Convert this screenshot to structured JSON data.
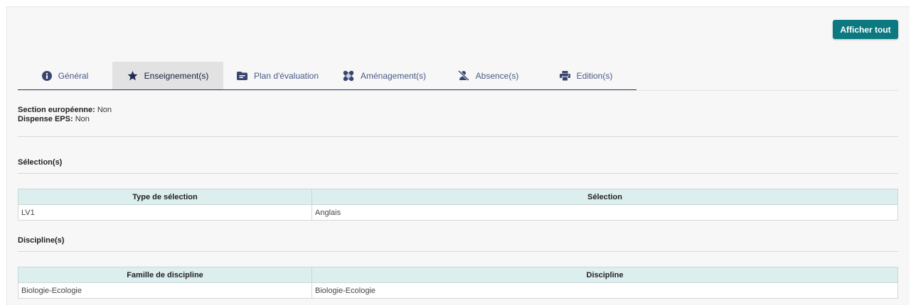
{
  "header": {
    "show_all_label": "Afficher tout"
  },
  "tabs": [
    {
      "label": "Général",
      "icon": "info-circle-icon"
    },
    {
      "label": "Enseignement(s)",
      "icon": "star-icon",
      "active": true
    },
    {
      "label": "Plan d'évaluation",
      "icon": "folder-list-icon"
    },
    {
      "label": "Aménagement(s)",
      "icon": "bandage-icon"
    },
    {
      "label": "Absence(s)",
      "icon": "person-off-icon"
    },
    {
      "label": "Edition(s)",
      "icon": "printer-icon"
    }
  ],
  "info": {
    "section_label": "Section européenne:",
    "section_value": "Non",
    "eps_label": "Dispense EPS:",
    "eps_value": "Non"
  },
  "selections": {
    "title": "Sélection(s)",
    "headers": [
      "Type de sélection",
      "Sélection"
    ],
    "rows": [
      [
        "LV1",
        "Anglais"
      ]
    ]
  },
  "disciplines": {
    "title": "Discipline(s)",
    "headers": [
      "Famille de discipline",
      "Discipline"
    ],
    "rows": [
      [
        "Biologie-Ecologie",
        "Biologie-Ecologie"
      ]
    ]
  },
  "colors": {
    "accent": "#0c7880",
    "tab_active_bg": "#e2e2e2",
    "table_header_bg": "#dcefee"
  }
}
